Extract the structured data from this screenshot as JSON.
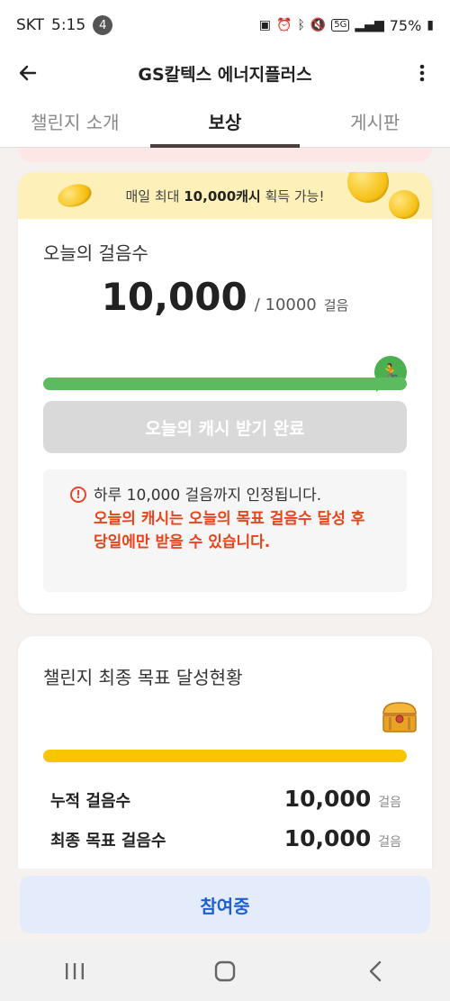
{
  "status_bar": {
    "carrier": "SKT",
    "time": "5:15",
    "notification_count": "4",
    "network": "5G",
    "battery": "75%"
  },
  "app_bar": {
    "title": "GS칼텍스 에너지플러스"
  },
  "tabs": [
    {
      "label": "챌린지 소개",
      "active": false
    },
    {
      "label": "보상",
      "active": true
    },
    {
      "label": "게시판",
      "active": false
    }
  ],
  "daily_card": {
    "promo_prefix": "매일 최대 ",
    "promo_amount": "10,000캐시",
    "promo_suffix": " 획득 가능!",
    "title": "오늘의 걸음수",
    "steps": "10,000",
    "goal": "/ 10000",
    "unit": "걸음",
    "progress": 1.0,
    "progress_color": "#5cbb5e",
    "button_label": "오늘의 캐시 받기 완료",
    "notice_line1": "하루 10,000 걸음까지 인정됩니다.",
    "notice_line2": "오늘의 캐시는 오늘의 목표 걸음수 달성 후",
    "notice_line3": "당일에만 받을 수 있습니다."
  },
  "challenge_card": {
    "title": "챌린지 최종 목표 달성현황",
    "progress": 1.0,
    "progress_color": "#f7c600",
    "rows": [
      {
        "label": "누적 걸음수",
        "value": "10,000",
        "unit": "걸음"
      },
      {
        "label": "최종 목표 걸음수",
        "value": "10,000",
        "unit": "걸음"
      }
    ]
  },
  "bottom": {
    "join_label": "참여중"
  },
  "icons": {
    "back": "arrow-left-icon",
    "more": "more-vertical-icon",
    "runner": "runner-icon",
    "notice": "exclamation-circle-icon",
    "chest": "treasure-chest-icon",
    "coin": "coin-icon"
  }
}
